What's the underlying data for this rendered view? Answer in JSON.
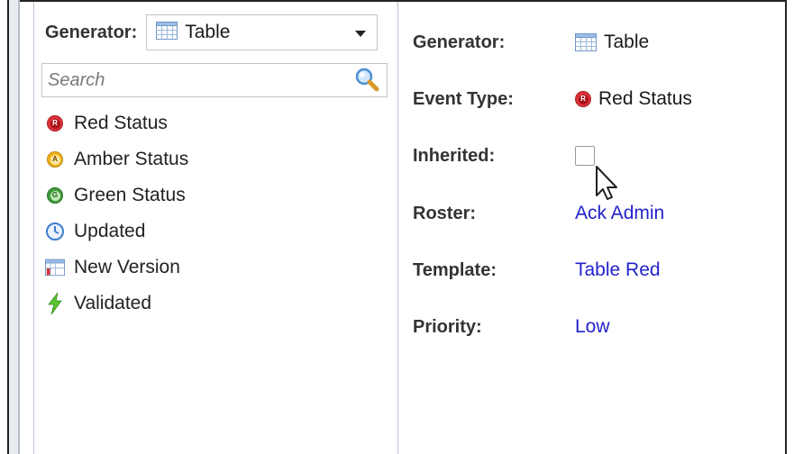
{
  "generator": {
    "label": "Generator:",
    "selected": "Table",
    "selected_icon": "table-icon"
  },
  "search": {
    "placeholder": "Search",
    "value": "",
    "icon": "magnifier-icon"
  },
  "event_types": [
    {
      "label": "Red Status",
      "icon": "red-status-icon",
      "badge": "R",
      "color": "#e0303a"
    },
    {
      "label": "Amber Status",
      "icon": "amber-status-icon",
      "badge": "A",
      "color": "#f2b21a"
    },
    {
      "label": "Green Status",
      "icon": "green-status-icon",
      "badge": "G",
      "color": "#3f9a3a"
    },
    {
      "label": "Updated",
      "icon": "clock-refresh-icon"
    },
    {
      "label": "New Version",
      "icon": "table-version-icon"
    },
    {
      "label": "Validated",
      "icon": "lightning-icon"
    }
  ],
  "details": {
    "generator": {
      "label": "Generator:",
      "value": "Table"
    },
    "event_type": {
      "label": "Event Type:",
      "value": "Red Status",
      "badge": "R"
    },
    "inherited": {
      "label": "Inherited:",
      "checked": false
    },
    "roster": {
      "label": "Roster:",
      "value": "Ack Admin"
    },
    "template": {
      "label": "Template:",
      "value": "Table Red"
    },
    "priority": {
      "label": "Priority:",
      "value": "Low"
    }
  },
  "colors": {
    "link": "#2222cc",
    "panel_border": "#b8c6d8"
  }
}
